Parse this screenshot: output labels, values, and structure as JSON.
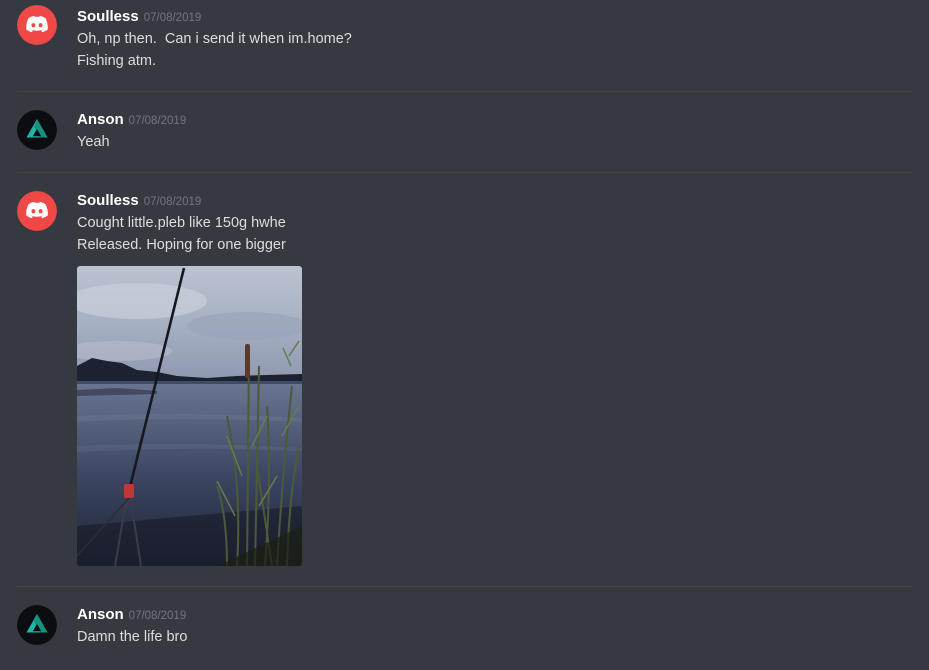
{
  "messages": [
    {
      "author": "Soulless",
      "timestamp": "07/08/2019",
      "avatar": "discord-logo-icon",
      "avatar_color": "#f04747",
      "lines": [
        "Oh, np then.  Can i send it when im.home?",
        "Fishing atm."
      ]
    },
    {
      "author": "Anson",
      "timestamp": "07/08/2019",
      "avatar": "triangle-logo-icon",
      "avatar_color": "#0b0d10",
      "lines": [
        "Yeah"
      ]
    },
    {
      "author": "Soulless",
      "timestamp": "07/08/2019",
      "avatar": "discord-logo-icon",
      "avatar_color": "#f04747",
      "lines": [
        "Cought little.pleb like 150g hwhe",
        "Released. Hoping for one bigger"
      ],
      "attachment": "fishing-lake-photo"
    },
    {
      "author": "Anson",
      "timestamp": "07/08/2019",
      "avatar": "triangle-logo-icon",
      "avatar_color": "#0b0d10",
      "lines": [
        "Damn the life bro"
      ]
    }
  ],
  "colors": {
    "background": "#36393f",
    "username": "#ffffff",
    "message_text": "#dcddde",
    "timestamp": "#72767d",
    "divider": "#42454a"
  }
}
